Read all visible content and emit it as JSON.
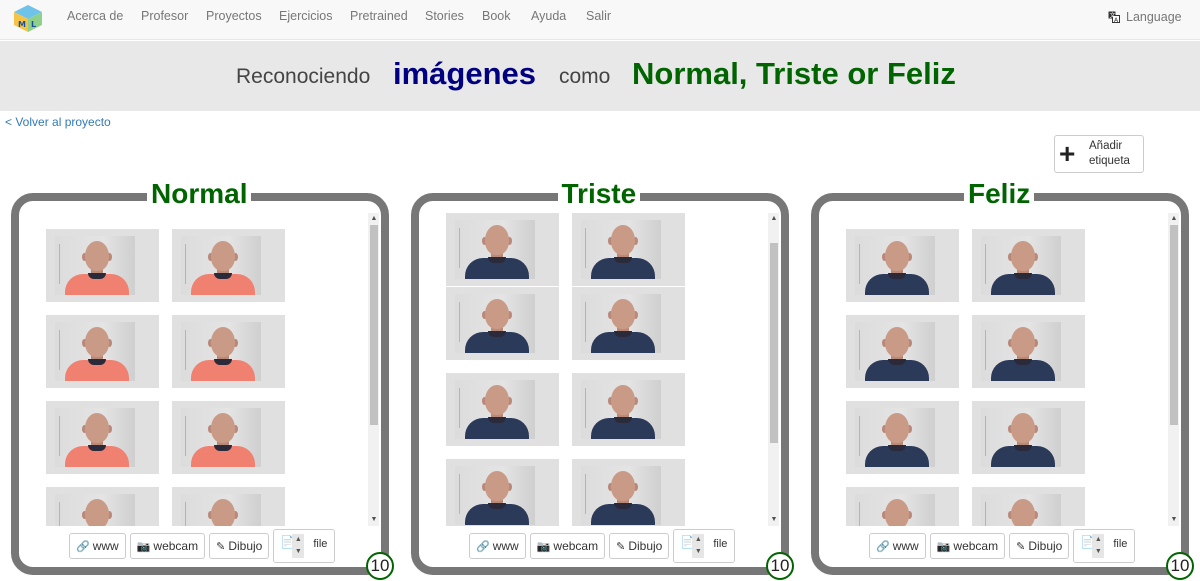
{
  "nav": {
    "items": [
      "Acerca de",
      "Profesor",
      "Proyectos",
      "Ejercicios",
      "Pretrained",
      "Stories",
      "Book",
      "Ayuda",
      "Salir"
    ],
    "language": "Language",
    "logo_icon": "ml4kids-logo-icon"
  },
  "banner": {
    "word1": "Reconociendo",
    "word2": "imágenes",
    "word3": "como",
    "word4": "Normal, Triste or Feliz"
  },
  "back_link": "< Volver al proyecto",
  "add_label": {
    "line1": "Añadir",
    "line2": "etiqueta"
  },
  "buttons": {
    "www": "www",
    "webcam": "webcam",
    "dibujo": "Dibujo",
    "file": "file"
  },
  "buckets": [
    {
      "title": "Normal",
      "count": "10",
      "shirt_color": "#f08070"
    },
    {
      "title": "Triste",
      "count": "10",
      "shirt_color": "#2c3a5a"
    },
    {
      "title": "Feliz",
      "count": "10",
      "shirt_color": "#2c3a5a"
    }
  ],
  "colors": {
    "label_green": "#006400",
    "navy": "#000080",
    "border_gray": "#777777"
  }
}
